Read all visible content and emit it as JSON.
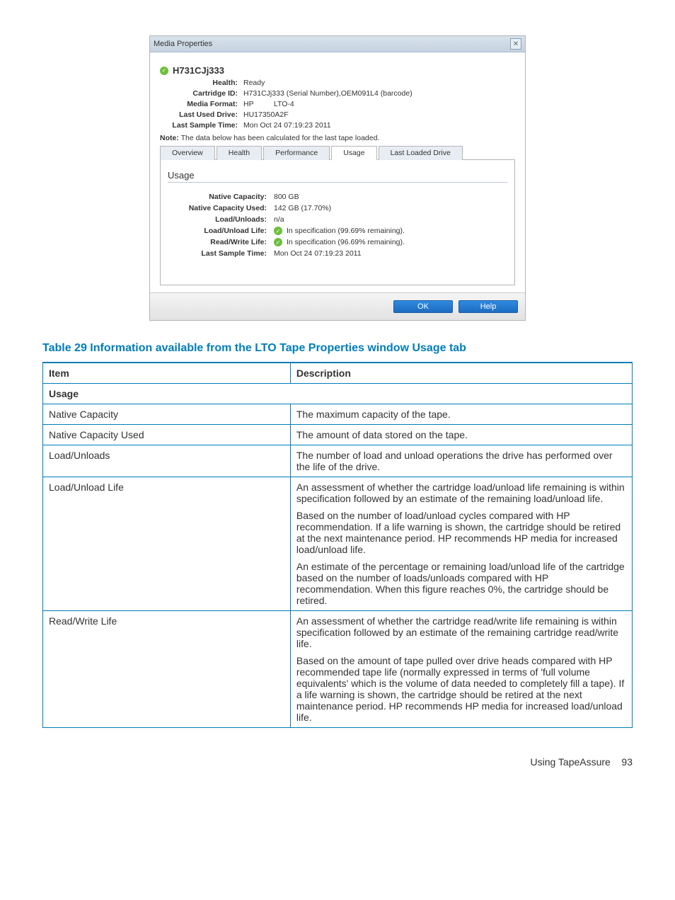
{
  "dialog": {
    "title": "Media Properties",
    "media_name": "H731CJj333",
    "fields": {
      "health_label": "Health:",
      "health_value": "Ready",
      "cartridge_id_label": "Cartridge ID:",
      "cartridge_id_value": "H731CJj333 (Serial Number),OEM091L4 (barcode)",
      "media_format_label": "Media Format:",
      "media_format_mfr": "HP",
      "media_format_type": "LTO-4",
      "last_used_drive_label": "Last Used Drive:",
      "last_used_drive_value": "HU17350A2F",
      "last_sample_time_label": "Last Sample Time:",
      "last_sample_time_value": "Mon Oct 24 07:19:23 2011",
      "note_label": "Note:",
      "note_text": "The data below has been calculated for the last tape loaded."
    },
    "tabs": {
      "overview": "Overview",
      "health": "Health",
      "performance": "Performance",
      "usage": "Usage",
      "last_loaded": "Last Loaded Drive"
    },
    "section_title": "Usage",
    "usage": {
      "native_capacity_label": "Native Capacity:",
      "native_capacity_value": "800 GB",
      "native_capacity_used_label": "Native Capacity Used:",
      "native_capacity_used_value": "142 GB (17.70%)",
      "load_unloads_label": "Load/Unloads:",
      "load_unloads_value": "n/a",
      "load_unload_life_label": "Load/Unload Life:",
      "load_unload_life_value": "In specification (99.69% remaining).",
      "read_write_life_label": "Read/Write Life:",
      "read_write_life_value": "In specification (96.69% remaining).",
      "last_sample_time_label": "Last Sample Time:",
      "last_sample_time_value": "Mon Oct 24 07:19:23 2011"
    },
    "buttons": {
      "ok": "OK",
      "help": "Help"
    }
  },
  "table": {
    "caption": "Table 29 Information available from the LTO Tape Properties window Usage tab",
    "header_item": "Item",
    "header_desc": "Description",
    "section": "Usage",
    "rows": [
      {
        "item": "Native Capacity",
        "desc": [
          "The maximum capacity of the tape."
        ]
      },
      {
        "item": "Native Capacity Used",
        "desc": [
          "The amount of data stored on the tape."
        ]
      },
      {
        "item": "Load/Unloads",
        "desc": [
          "The number of load and unload operations the drive has performed over the life of the drive."
        ]
      },
      {
        "item": "Load/Unload Life",
        "desc": [
          "An assessment of whether the cartridge load/unload life remaining is within specification followed by an estimate of the remaining load/unload life.",
          "Based on the number of load/unload cycles compared with HP recommendation. If a life warning is shown, the cartridge should be retired at the next maintenance period. HP recommends HP media for increased load/unload life.",
          "An estimate of the percentage or remaining load/unload life of the cartridge based on the number of loads/unloads compared with HP recommendation. When this figure reaches 0%, the cartridge should be retired."
        ]
      },
      {
        "item": "Read/Write Life",
        "desc": [
          "An assessment of whether the cartridge read/write life remaining is within specification followed by an estimate of the remaining cartridge read/write life.",
          "Based on the amount of tape pulled over drive heads compared with HP recommended tape life (normally expressed in terms of 'full volume equivalents' which is the volume of data needed to completely fill a tape). If a life warning is shown, the cartridge should be retired at the next maintenance period. HP recommends HP media for increased load/unload life."
        ]
      }
    ]
  },
  "footer": {
    "text": "Using TapeAssure",
    "page": "93"
  }
}
